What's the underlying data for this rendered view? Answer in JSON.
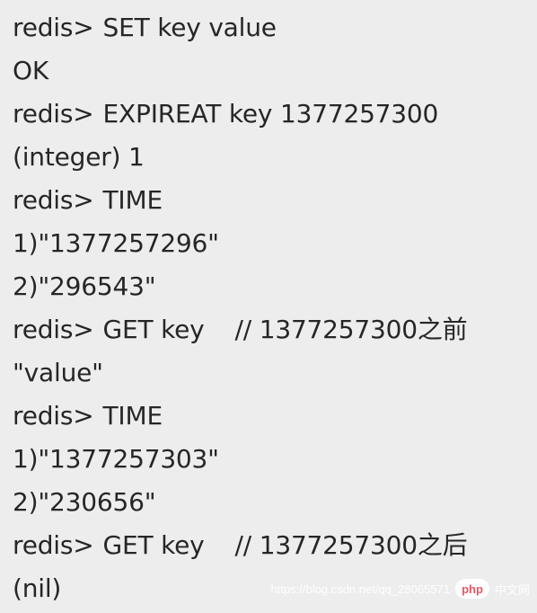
{
  "terminal": {
    "prompt": "redis>",
    "lines": [
      {
        "type": "cmd",
        "command": "SET key value"
      },
      {
        "type": "out",
        "text": "OK"
      },
      {
        "type": "cmd",
        "command": "EXPIREAT key 1377257300"
      },
      {
        "type": "out",
        "text": "(integer) 1"
      },
      {
        "type": "cmd",
        "command": "TIME"
      },
      {
        "type": "out",
        "text": "1)\"1377257296\""
      },
      {
        "type": "out",
        "text": "2)\"296543\""
      },
      {
        "type": "cmd",
        "command": "GET key",
        "comment": "// 1377257300之前"
      },
      {
        "type": "out",
        "text": "\"value\""
      },
      {
        "type": "cmd",
        "command": "TIME"
      },
      {
        "type": "out",
        "text": "1)\"1377257303\""
      },
      {
        "type": "out",
        "text": "2)\"230656\""
      },
      {
        "type": "cmd",
        "command": "GET key",
        "comment": "// 1377257300之后"
      },
      {
        "type": "out",
        "text": "(nil)"
      }
    ]
  },
  "watermark": {
    "logo_text": "php",
    "site_name": "中文网",
    "url_text": "https://blog.csdn.net/qq_28065571"
  },
  "colors": {
    "background": "#ededed",
    "text": "#262626"
  }
}
